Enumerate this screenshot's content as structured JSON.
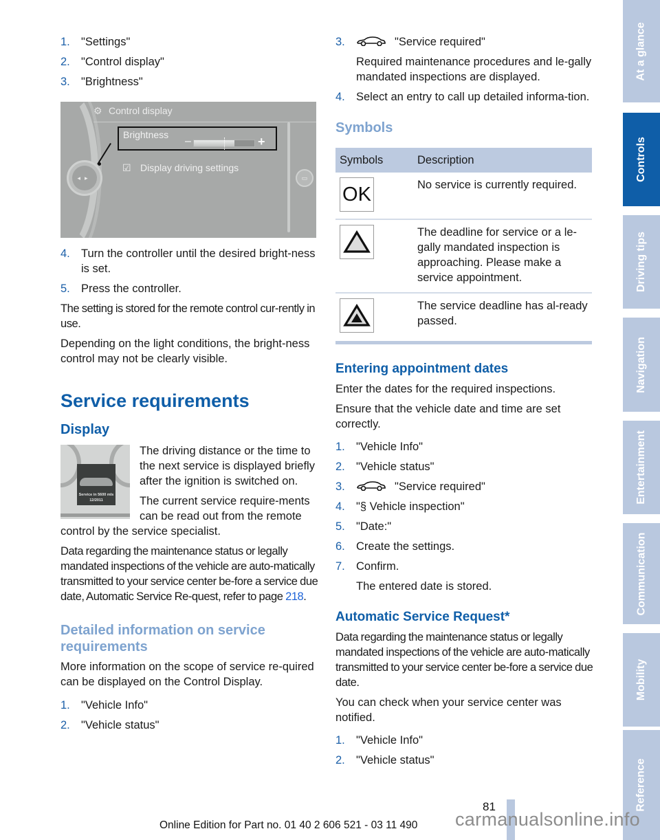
{
  "left_column": {
    "steps_top": [
      {
        "num": "1.",
        "text": "\"Settings\""
      },
      {
        "num": "2.",
        "text": "\"Control display\""
      },
      {
        "num": "3.",
        "text": "\"Brightness\""
      }
    ],
    "screen": {
      "header": "Control display",
      "selected_item": "Brightness",
      "minus": "–",
      "plus": "+",
      "brightness_level": 0.67,
      "checkbox_item": "Display driving settings"
    },
    "steps_after": [
      {
        "num": "4.",
        "text": "Turn the controller until the desired bright-ness is set."
      },
      {
        "num": "5.",
        "text": "Press the controller."
      }
    ],
    "para1": "The setting is stored for the remote control cur-rently in use.",
    "para2": "Depending on the light conditions, the bright-ness control may not be clearly visible.",
    "h1": "Service requirements",
    "display_heading": "Display",
    "cluster": {
      "line1": "Service in 5600 mls",
      "line2": "12/2011"
    },
    "display_para1": "The driving distance or the time to the next service is displayed briefly after the ignition is switched on.",
    "display_para2": "The current service require-ments can be read out from the remote control by the service specialist.",
    "data_para_prefix": "Data regarding the maintenance status or legally mandated inspections of the vehicle are auto-matically transmitted to your service center be-fore a service due date, Automatic Service Re-quest, refer to page ",
    "data_para_link": "218",
    "data_para_suffix": ".",
    "detail_heading": "Detailed information on service requirements",
    "detail_para": "More information on the scope of service re-quired can be displayed on the Control Display.",
    "detail_steps": [
      {
        "num": "1.",
        "text": "\"Vehicle Info\""
      },
      {
        "num": "2.",
        "text": "\"Vehicle status\""
      }
    ]
  },
  "right_column": {
    "step3": {
      "num": "3.",
      "icon": "car-icon",
      "text": "\"Service required\""
    },
    "step3_sub": "Required maintenance procedures and le-gally mandated inspections are displayed.",
    "step4": {
      "num": "4.",
      "text": "Select an entry to call up detailed informa-tion."
    },
    "symbols_heading": "Symbols",
    "table": {
      "headers": [
        "Symbols",
        "Description"
      ],
      "rows": [
        {
          "symbol": "ok-icon",
          "symbol_text": "OK",
          "description": "No service is currently required."
        },
        {
          "symbol": "warning-triangle-icon",
          "description": "The deadline for service or a le-gally mandated inspection is approaching. Please make a service appointment."
        },
        {
          "symbol": "overdue-triangle-icon",
          "description": "The service deadline has al-ready passed."
        }
      ]
    },
    "appt_heading": "Entering appointment dates",
    "appt_para1": "Enter the dates for the required inspections.",
    "appt_para2": "Ensure that the vehicle date and time are set correctly.",
    "appt_steps": [
      {
        "num": "1.",
        "text": "\"Vehicle Info\""
      },
      {
        "num": "2.",
        "text": "\"Vehicle status\""
      },
      {
        "num": "3.",
        "text": "\"Service required\"",
        "icon": "car-icon"
      },
      {
        "num": "4.",
        "text": "\"§ Vehicle inspection\""
      },
      {
        "num": "5.",
        "text": "\"Date:\""
      },
      {
        "num": "6.",
        "text": "Create the settings."
      },
      {
        "num": "7.",
        "text": "Confirm."
      }
    ],
    "appt_step7_sub": "The entered date is stored.",
    "asr_heading": "Automatic Service Request*",
    "asr_para1": "Data regarding the maintenance status or legally mandated inspections of the vehicle are auto-matically transmitted to your service center be-fore a service due date.",
    "asr_para2": "You can check when your service center was notified.",
    "asr_steps": [
      {
        "num": "1.",
        "text": "\"Vehicle Info\""
      },
      {
        "num": "2.",
        "text": "\"Vehicle status\""
      }
    ]
  },
  "sidebar": {
    "tabs": [
      {
        "label": "At a glance",
        "active": false
      },
      {
        "label": "Controls",
        "active": true
      },
      {
        "label": "Driving tips",
        "active": false
      },
      {
        "label": "Navigation",
        "active": false
      },
      {
        "label": "Entertainment",
        "active": false
      },
      {
        "label": "Communication",
        "active": false
      },
      {
        "label": "Mobility",
        "active": false
      },
      {
        "label": "Reference",
        "active": false
      }
    ]
  },
  "footer": {
    "page_number": "81",
    "edition": "Online Edition for Part no. 01 40 2 606 521 - 03 11 490",
    "watermark": "carmanualsonline.info"
  },
  "colors": {
    "accent": "#0f5ea8",
    "light_heading": "#7ea3cf",
    "tab_inactive": "#b9c8df",
    "link": "#1d63d8"
  }
}
